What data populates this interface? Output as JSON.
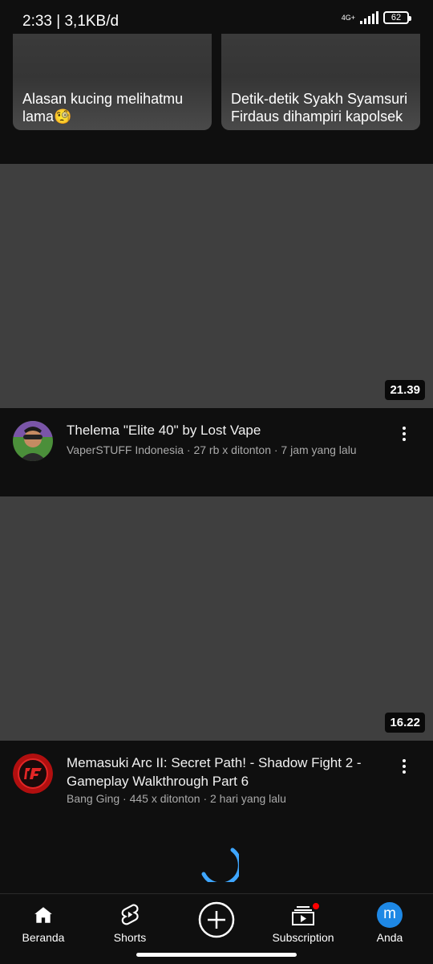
{
  "status_bar": {
    "time_speed": "2:33 | 3,1KB/d",
    "network": "4G+",
    "battery": "62"
  },
  "shorts": [
    {
      "title": "Alasan kucing melihatmu lama🧐"
    },
    {
      "title": "Detik-detik Syakh Syamsuri Firdaus dihampiri kapolsek"
    }
  ],
  "videos": [
    {
      "duration": "21.39",
      "title": "Thelema \"Elite 40\" by Lost Vape",
      "subtitle": "VaperSTUFF Indonesia · 27 rb x ditonton · 7 jam yang lalu",
      "avatar_icon": "channel-avatar-person"
    },
    {
      "duration": "16.22",
      "title": "Memasuki Arc II: Secret Path! - Shadow Fight 2 - Gameplay Walkthrough Part 6",
      "subtitle": "Bang Ging · 445 x ditonton · 2 hari yang lalu",
      "avatar_icon": "channel-avatar-logo"
    }
  ],
  "nav": {
    "home": "Beranda",
    "shorts": "Shorts",
    "create_icon": "plus-circle-icon",
    "subscription": "Subscription",
    "you": "Anda",
    "you_initial": "m"
  },
  "colors": {
    "background": "#0f0f0f",
    "thumbnail": "#3f3f3f",
    "spinner": "#3ea6ff",
    "notification_dot": "#ff0000",
    "avatar_blue": "#1e88e5"
  }
}
